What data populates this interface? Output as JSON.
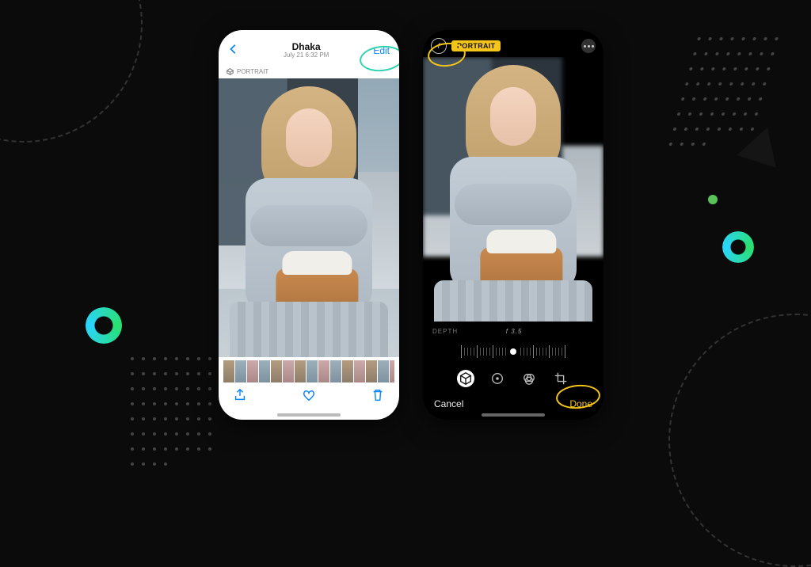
{
  "left_phone": {
    "title": "Dhaka",
    "subtitle": "July 21 6:32 PM",
    "edit_label": "Edit",
    "portrait_badge": "PORTRAIT"
  },
  "right_phone": {
    "portrait_badge": "PORTRAIT",
    "aperture_symbol": "f",
    "depth_label": "DEPTH",
    "depth_value": "f 3.5",
    "cancel_label": "Cancel",
    "done_label": "Done"
  },
  "highlights": {
    "edit_circle_color": "#2ed3b0",
    "aperture_circle_color": "#f5c518",
    "done_circle_color": "#f5c518"
  }
}
